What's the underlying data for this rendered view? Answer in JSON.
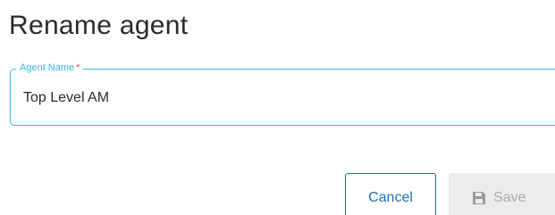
{
  "dialog": {
    "title": "Rename agent"
  },
  "agent_name_field": {
    "label": "Agent Name",
    "required_marker": "*",
    "value": "Top Level AM"
  },
  "actions": {
    "cancel_label": "Cancel",
    "save_label": "Save",
    "save_icon": "floppy-disk-icon",
    "save_disabled": true
  },
  "colors": {
    "accent": "#41b4e6",
    "primary": "#1e6fb0",
    "required": "#e0405a",
    "disabled_bg": "#ececec",
    "disabled_text": "#a9a9a9"
  }
}
